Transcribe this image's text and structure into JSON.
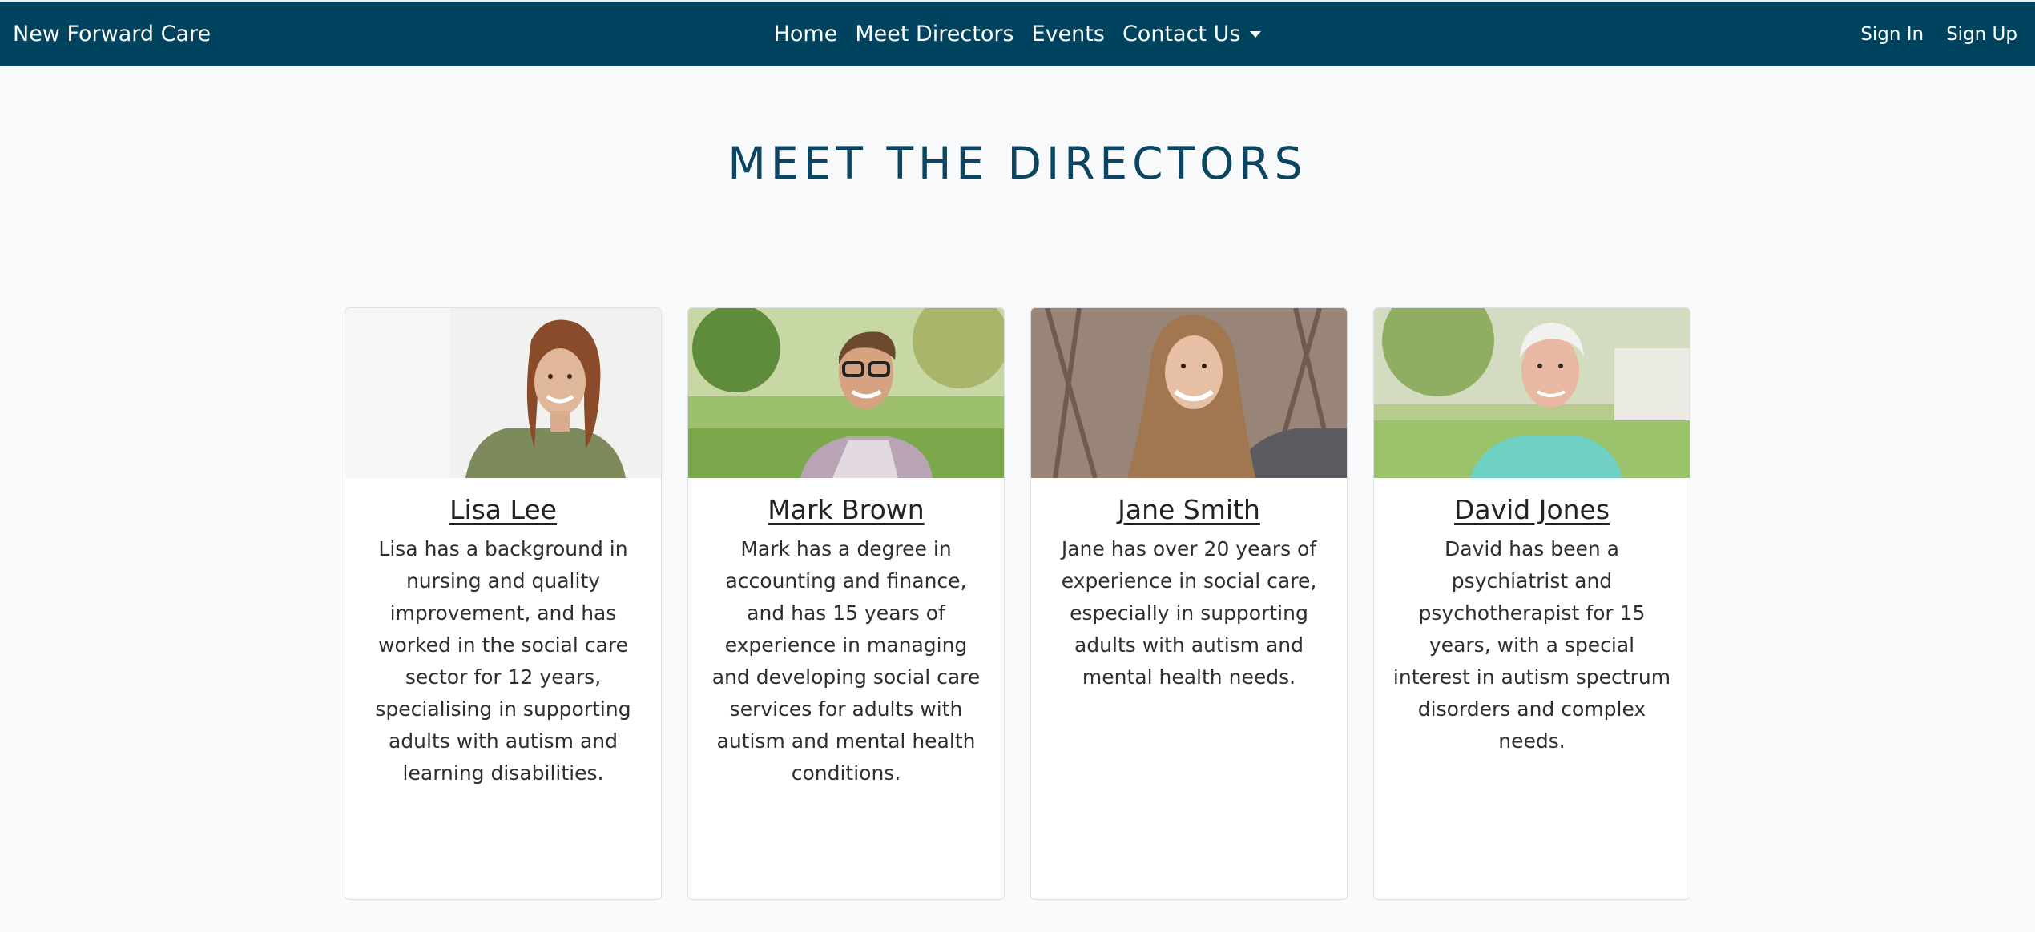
{
  "nav": {
    "brand": "New Forward Care",
    "links": [
      "Home",
      "Meet Directors",
      "Events",
      "Contact Us"
    ],
    "sign_in": "Sign In",
    "sign_up": "Sign Up",
    "background": "#00435f"
  },
  "page": {
    "title": "MEET THE DIRECTORS",
    "title_color": "#0c4562"
  },
  "directors": [
    {
      "name": "Lisa Lee",
      "bio": "Lisa has a background in nursing and quality improvement, and has worked in the social care sector for 12 years, specialising in supporting adults with autism and learning disabilities.",
      "photo_icon": "woman-portrait-photo"
    },
    {
      "name": "Mark Brown",
      "bio": "Mark has a degree in accounting and finance, and has 15 years of experience in managing and developing social care services for adults with autism and mental health conditions.",
      "photo_icon": "man-with-glasses-portrait-photo"
    },
    {
      "name": "Jane Smith",
      "bio": "Jane has over 20 years of experience in social care, especially in supporting adults with autism and mental health needs.",
      "photo_icon": "woman-long-hair-portrait-photo"
    },
    {
      "name": "David Jones",
      "bio": "David has been a psychiatrist and psychotherapist for 15 years, with a special interest in autism spectrum disorders and complex needs.",
      "photo_icon": "elderly-man-portrait-photo"
    }
  ]
}
